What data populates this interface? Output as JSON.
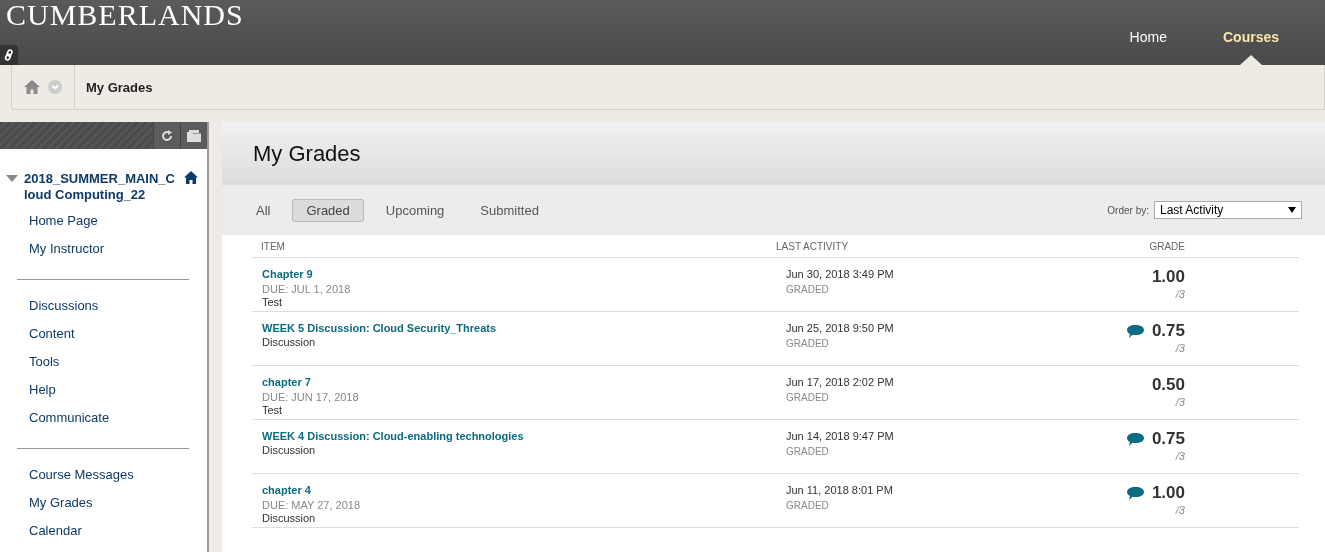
{
  "header": {
    "logo": "CUMBERLANDS",
    "nav": [
      {
        "label": "Home",
        "selected": false
      },
      {
        "label": "Courses",
        "selected": true
      }
    ]
  },
  "breadcrumb": {
    "current": "My Grades"
  },
  "sidebar": {
    "course": "2018_SUMMER_MAIN_Cloud Computing_22",
    "groups": [
      [
        "Home Page",
        "My Instructor"
      ],
      [
        "Discussions",
        "Content",
        "Tools",
        "Help",
        "Communicate"
      ],
      [
        "Course Messages",
        "My Grades",
        "Calendar"
      ]
    ]
  },
  "main": {
    "title": "My Grades",
    "filters": [
      {
        "label": "All",
        "selected": false
      },
      {
        "label": "Graded",
        "selected": true
      },
      {
        "label": "Upcoming",
        "selected": false
      },
      {
        "label": "Submitted",
        "selected": false
      }
    ],
    "order_by": {
      "label": "Order by:",
      "value": "Last Activity"
    },
    "columns": [
      "ITEM",
      "LAST ACTIVITY",
      "GRADE"
    ],
    "rows": [
      {
        "title": "Chapter 9",
        "due": "DUE: JUL 1, 2018",
        "type": "Test",
        "activity": "Jun 30, 2018 3:49 PM",
        "status": "GRADED",
        "grade": "1.00",
        "out_of": "/3",
        "feedback": false
      },
      {
        "title": "WEEK 5 Discussion: Cloud Security_Threats",
        "type": "Discussion",
        "activity": "Jun 25, 2018 9:50 PM",
        "status": "GRADED",
        "grade": "0.75",
        "out_of": "/3",
        "feedback": true
      },
      {
        "title": "chapter 7",
        "due": "DUE: JUN 17, 2018",
        "type": "Test",
        "activity": "Jun 17, 2018 2:02 PM",
        "status": "GRADED",
        "grade": "0.50",
        "out_of": "/3",
        "feedback": false
      },
      {
        "title": "WEEK 4 Discussion: Cloud-enabling technologies",
        "type": "Discussion",
        "activity": "Jun 14, 2018 9:47 PM",
        "status": "GRADED",
        "grade": "0.75",
        "out_of": "/3",
        "feedback": true
      },
      {
        "title": "chapter 4",
        "due": "DUE: MAY 27, 2018",
        "type": "Discussion",
        "activity": "Jun 11, 2018 8:01 PM",
        "status": "GRADED",
        "grade": "1.00",
        "out_of": "/3",
        "feedback": true
      }
    ]
  }
}
